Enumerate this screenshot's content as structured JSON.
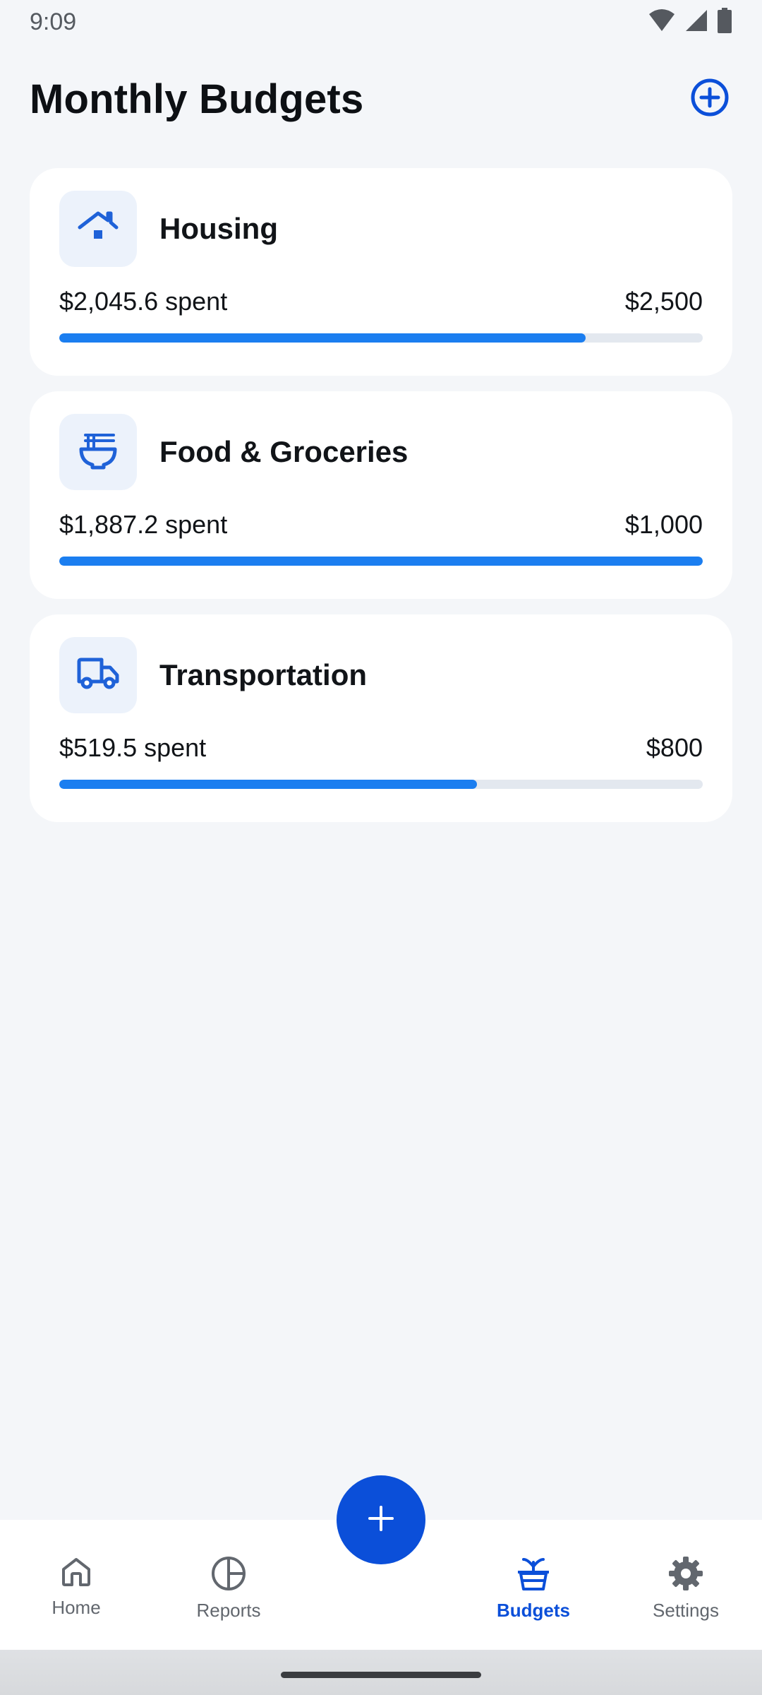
{
  "status_bar": {
    "time": "9:09"
  },
  "header": {
    "title": "Monthly Budgets"
  },
  "budgets": [
    {
      "name": "Housing",
      "spent": "$2,045.6 spent",
      "limit": "$2,500",
      "progress": 0.818,
      "icon": "house-icon"
    },
    {
      "name": "Food & Groceries",
      "spent": "$1,887.2 spent",
      "limit": "$1,000",
      "progress": 1.0,
      "icon": "noodle-bowl-icon"
    },
    {
      "name": "Transportation",
      "spent": "$519.5 spent",
      "limit": "$800",
      "progress": 0.649,
      "icon": "truck-icon"
    }
  ],
  "nav": {
    "items": [
      {
        "label": "Home",
        "icon": "home-icon",
        "active": false
      },
      {
        "label": "Reports",
        "icon": "pie-chart-icon",
        "active": false
      },
      {
        "label": "Budgets",
        "icon": "plant-pot-icon",
        "active": true
      },
      {
        "label": "Settings",
        "icon": "gear-icon",
        "active": false
      }
    ]
  },
  "colors": {
    "accent": "#0b4fd9",
    "progress": "#1b7ef0",
    "track": "#e3e8ef",
    "background": "#f4f6f9",
    "icon_tile": "#ecf2fb"
  }
}
